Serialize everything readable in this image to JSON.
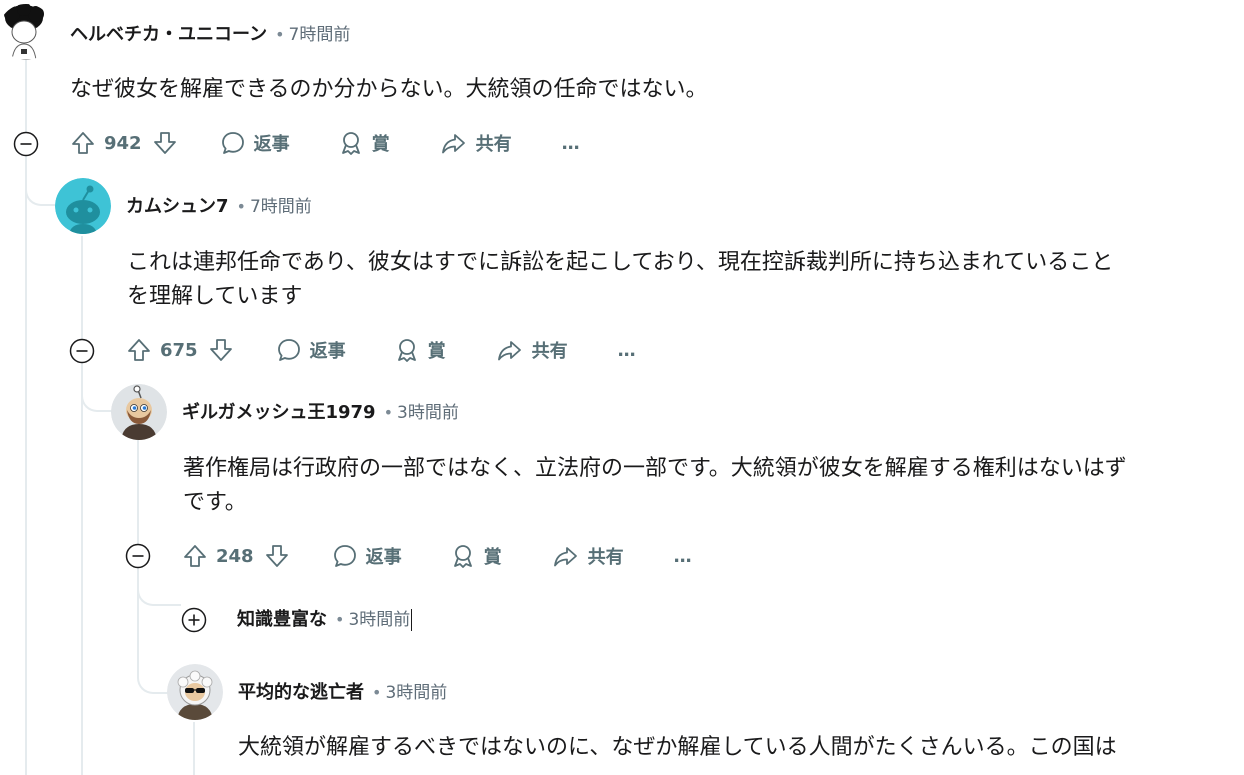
{
  "comments": [
    {
      "author": "ヘルベチカ・ユニコーン",
      "separator": "•",
      "time": "7時間前",
      "body": "なぜ彼女を解雇できるのか分からない。大統領の任命ではない。",
      "votes": "942",
      "reply_label": "返事",
      "award_label": "賞",
      "share_label": "共有",
      "more_label": "…"
    },
    {
      "author": "カムシュン7",
      "separator": "•",
      "time": "7時間前",
      "body_lines": [
        "これは連邦任命であり、彼女はすでに訴訟を起こしており、現在控訴裁判所に持ち込まれていること",
        "を理解しています"
      ],
      "votes": "675",
      "reply_label": "返事",
      "award_label": "賞",
      "share_label": "共有",
      "more_label": "…"
    },
    {
      "author": "ギルガメッシュ王1979",
      "separator": "•",
      "time": "3時間前",
      "body_lines": [
        "著作権局は行政府の一部ではなく、立法府の一部です。大統領が彼女を解雇する権利はないはず",
        "です。"
      ],
      "votes": "248",
      "reply_label": "返事",
      "award_label": "賞",
      "share_label": "共有",
      "more_label": "…"
    },
    {
      "author": "知識豊富な",
      "separator": "•",
      "time": "3時間前",
      "collapsed": true
    },
    {
      "author": "平均的な逃亡者",
      "separator": "•",
      "time": "3時間前",
      "body_lines": [
        "大統領が解雇するべきではないのに、なぜか解雇している人間がたくさんいる。この国は"
      ]
    }
  ],
  "colors": {
    "thread_line": "#e5ebee",
    "meta": "#5f6d78",
    "action": "#576f76",
    "text": "#1a1a1b",
    "avatar2_bg": "#3ec3d6"
  }
}
